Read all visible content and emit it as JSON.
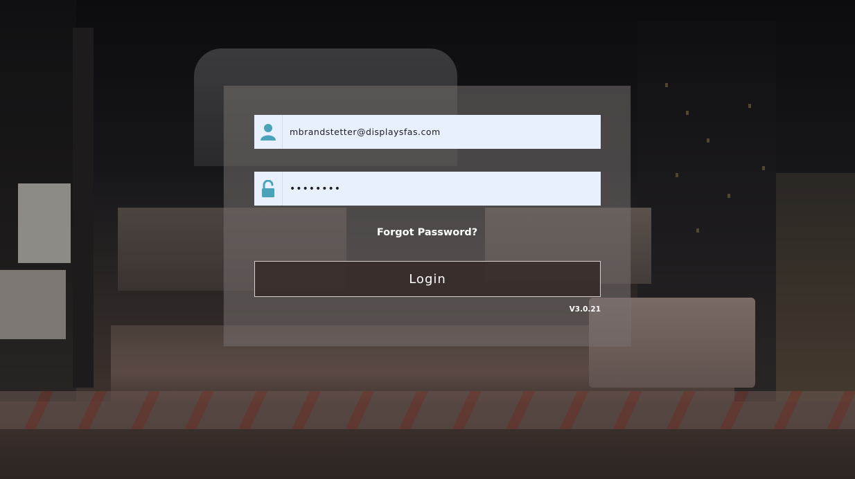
{
  "login_form": {
    "username_value": "mbrandstetter@displaysfas.com",
    "password_value": "••••••••",
    "forgot_password_label": "Forgot Password?",
    "login_label": "Login",
    "version": "V3.0.21"
  },
  "icons": {
    "username": "user-icon",
    "password": "unlocked-padlock-icon"
  },
  "colors": {
    "icon_accent": "#4aa3b8",
    "field_background": "#e8f0fe"
  }
}
